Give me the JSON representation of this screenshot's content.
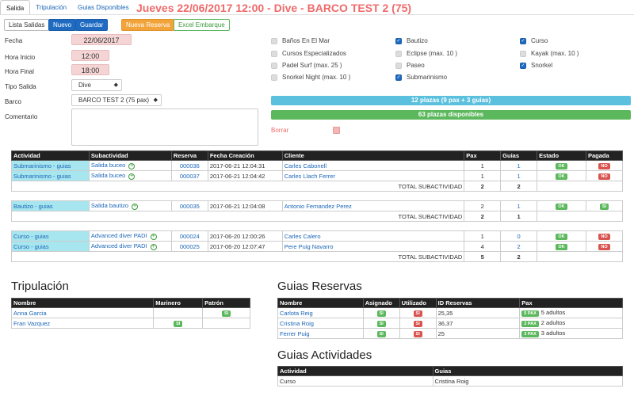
{
  "tabs": [
    "Salida",
    "Tripulación",
    "Guias Disponibles"
  ],
  "title": "Jueves 22/06/2017 12:00 - Dive - BARCO TEST 2 (75)",
  "toolbar": {
    "lista": "Lista Salidas",
    "nuevo": "Nuevo",
    "guardar": "Guardar",
    "reserva": "Nueva Reserva",
    "excel": "Excel Embarque"
  },
  "form": {
    "fecha_label": "Fecha",
    "fecha": "22/06/2017",
    "hora_inicio_label": "Hora Inicio",
    "hora_inicio": "12:00",
    "hora_final_label": "Hora Final",
    "hora_final": "18:00",
    "tipo_label": "Tipo Salida",
    "tipo": "Dive",
    "barco_label": "Barco",
    "barco": "BARCO TEST 2 (75 pax)",
    "comentario_label": "Comentario"
  },
  "activities": [
    {
      "label": "Baños En El Mar",
      "checked": false
    },
    {
      "label": "Bautizo",
      "checked": true
    },
    {
      "label": "Curso",
      "checked": true
    },
    {
      "label": "Cursos Especializados",
      "checked": false
    },
    {
      "label": "Eclipse (max. 10 )",
      "checked": false
    },
    {
      "label": "Kayak (max. 10 )",
      "checked": false
    },
    {
      "label": "Padel Surf (max. 25 )",
      "checked": false
    },
    {
      "label": "Paseo",
      "checked": false
    },
    {
      "label": "Snorkel",
      "checked": true
    },
    {
      "label": "Snorkel Night (max. 10 )",
      "checked": false
    },
    {
      "label": "Submarinismo",
      "checked": true
    }
  ],
  "bars": {
    "plazas": "12 plazas (9 pax + 3 guias)",
    "disponibles": "63 plazas disponibles",
    "borrar": "Borrar"
  },
  "colors": {
    "blue_bar": "#5bc0de",
    "green_bar": "#5cb85c",
    "title": "#f06a6a"
  },
  "reservas": {
    "headers": [
      "Actividad",
      "Subactividad",
      "Reserva",
      "Fecha Creación",
      "Cliente",
      "Pax",
      "Guias",
      "Estado",
      "Pagada"
    ],
    "total_label": "TOTAL SUBACTIVIDAD",
    "groups": [
      {
        "rows": [
          {
            "actividad": "Submarinismo  -  guias",
            "sub": "Salida buceo",
            "reserva": "000036",
            "fecha": "2017-06-21 12:04:31",
            "cliente": "Carles Cabonell",
            "pax": "1",
            "guias": "1",
            "estado": "OK",
            "pagada": "NO"
          },
          {
            "actividad": "Submarinismo  -  guias",
            "sub": "Salida buceo",
            "reserva": "000037",
            "fecha": "2017-06-21 12:04:42",
            "cliente": "Carles Llach Ferrer",
            "pax": "1",
            "guias": "1",
            "estado": "OK",
            "pagada": "NO"
          }
        ],
        "total_pax": "2",
        "total_guias": "2"
      },
      {
        "rows": [
          {
            "actividad": "Bautizo  -  guias",
            "sub": "Salida bautizo",
            "reserva": "000035",
            "fecha": "2017-06-21 12:04:08",
            "cliente": "Antonio Fernandez Perez",
            "pax": "2",
            "guias": "1",
            "estado": "OK",
            "pagada": "SI"
          }
        ],
        "total_pax": "2",
        "total_guias": "1"
      },
      {
        "rows": [
          {
            "actividad": "Curso  -  guias",
            "sub": "Advanced diver PADI",
            "reserva": "000024",
            "fecha": "2017-06-20 12:00:26",
            "cliente": "Carles Calero",
            "pax": "1",
            "guias": "0",
            "estado": "OK",
            "pagada": "NO"
          },
          {
            "actividad": "Curso  -  guias",
            "sub": "Advanced diver PADI",
            "reserva": "000025",
            "fecha": "2017-06-20 12:07:47",
            "cliente": "Pere Puig Navarro",
            "pax": "4",
            "guias": "2",
            "estado": "OK",
            "pagada": "NO"
          }
        ],
        "total_pax": "5",
        "total_guias": "2"
      }
    ]
  },
  "tripulacion": {
    "title": "Tripulación",
    "headers": [
      "Nombre",
      "Marinero",
      "Patrón"
    ],
    "rows": [
      {
        "nombre": "Anna Garcia",
        "marinero": "",
        "patron": "SI"
      },
      {
        "nombre": "Fran Vazquez",
        "marinero": "SI",
        "patron": ""
      }
    ]
  },
  "guias_reservas": {
    "title": "Guias Reservas",
    "headers": [
      "Nombre",
      "Asignado",
      "Utilizado",
      "ID Reservas",
      "Pax"
    ],
    "rows": [
      {
        "nombre": "Carlota Reig",
        "asignado": "SI",
        "utilizado": "SI",
        "ids": "25,35",
        "pax_badge": "5 PAX",
        "pax": "5 adultos"
      },
      {
        "nombre": "Cristina Roig",
        "asignado": "SI",
        "utilizado": "SI",
        "ids": "36,37",
        "pax_badge": "2 PAX",
        "pax": "2 adultos"
      },
      {
        "nombre": "Ferrer Puig",
        "asignado": "SI",
        "utilizado": "SI",
        "ids": "25",
        "pax_badge": "3 PAX",
        "pax": "3 adultos"
      }
    ]
  },
  "guias_actividades": {
    "title": "Guias Actividades",
    "headers": [
      "Actividad",
      "Guias"
    ],
    "rows": [
      {
        "actividad": "Curso",
        "guias": "Cristina Roig"
      }
    ]
  }
}
